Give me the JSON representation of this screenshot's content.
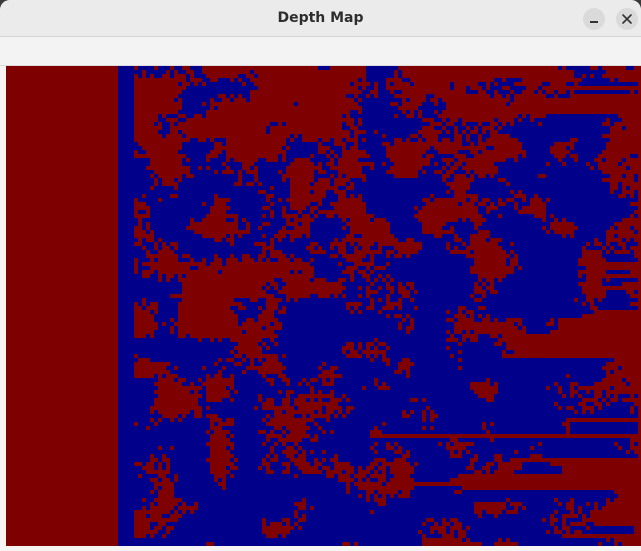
{
  "window": {
    "title": "Depth Map"
  },
  "controls": {
    "minimize_icon": "minimize-icon",
    "close_icon": "close-icon"
  },
  "depth_map": {
    "colors": {
      "near": "#7f0000",
      "far": "#00008b"
    }
  }
}
